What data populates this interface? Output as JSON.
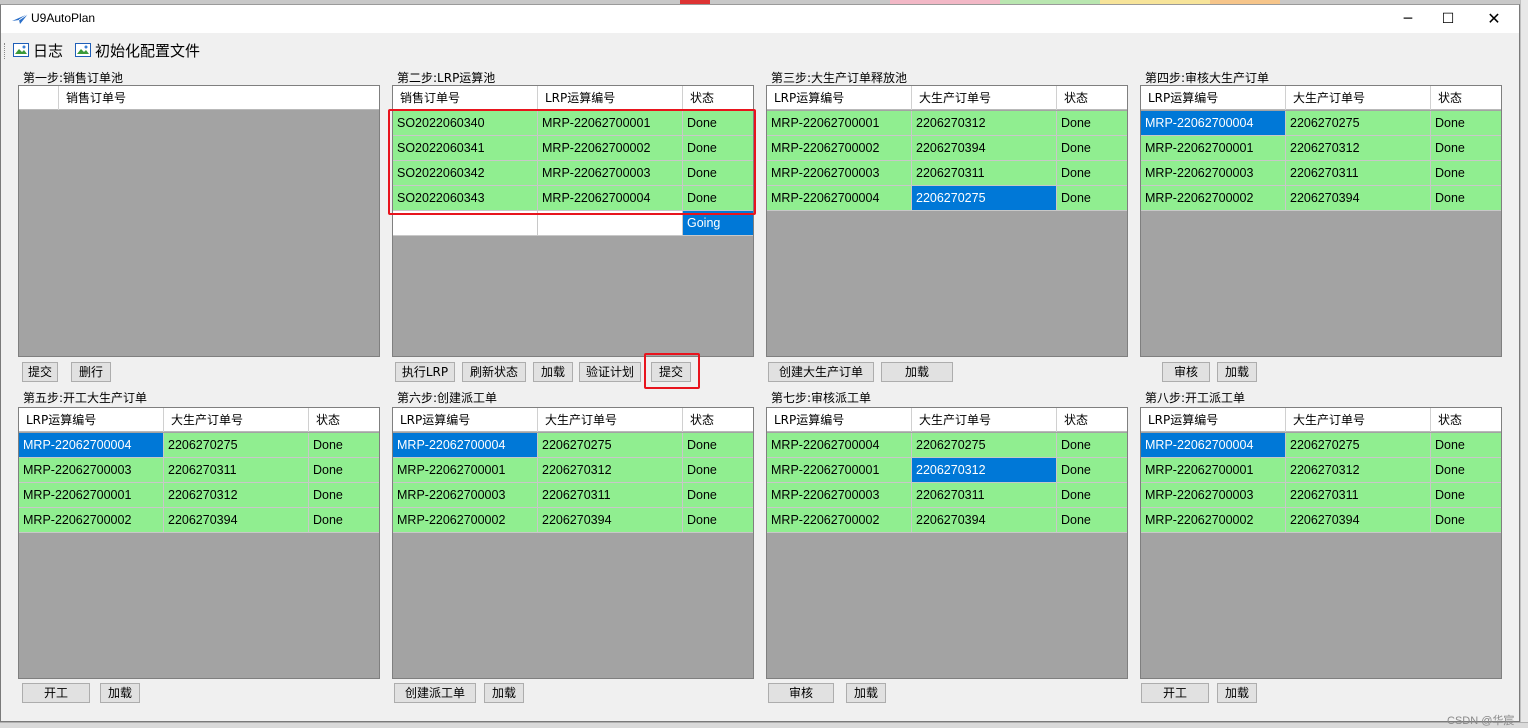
{
  "window": {
    "title": "U9AutoPlan",
    "minimize_glyph": "─",
    "maximize_glyph": "☐",
    "close_glyph": "✕"
  },
  "menu": {
    "log": "日志",
    "init_config": "初始化配置文件"
  },
  "panels": [
    {
      "title": "第一步:销售订单池",
      "columns": [
        "",
        "销售订单号"
      ],
      "rows": [],
      "buttons": [
        "提交",
        "删行"
      ]
    },
    {
      "title": "第二步:LRP运算池",
      "columns": [
        "销售订单号",
        "LRP运算编号",
        "状态"
      ],
      "rows": [
        [
          "SO2022060340",
          "MRP-22062700001",
          "Done"
        ],
        [
          "SO2022060341",
          "MRP-22062700002",
          "Done"
        ],
        [
          "SO2022060342",
          "MRP-22062700003",
          "Done"
        ],
        [
          "SO2022060343",
          "MRP-22062700004",
          "Done"
        ],
        [
          "",
          "",
          "Going"
        ]
      ],
      "buttons": [
        "执行LRP",
        "刷新状态",
        "加载",
        "验证计划",
        "提交"
      ]
    },
    {
      "title": "第三步:大生产订单释放池",
      "columns": [
        "LRP运算编号",
        "大生产订单号",
        "状态"
      ],
      "rows": [
        [
          "MRP-22062700001",
          "2206270312",
          "Done"
        ],
        [
          "MRP-22062700002",
          "2206270394",
          "Done"
        ],
        [
          "MRP-22062700003",
          "2206270311",
          "Done"
        ],
        [
          "MRP-22062700004",
          "2206270275",
          "Done"
        ]
      ],
      "buttons": [
        "创建大生产订单",
        "加载"
      ]
    },
    {
      "title": "第四步:审核大生产订单",
      "columns": [
        "LRP运算编号",
        "大生产订单号",
        "状态"
      ],
      "rows": [
        [
          "MRP-22062700004",
          "2206270275",
          "Done"
        ],
        [
          "MRP-22062700001",
          "2206270312",
          "Done"
        ],
        [
          "MRP-22062700003",
          "2206270311",
          "Done"
        ],
        [
          "MRP-22062700002",
          "2206270394",
          "Done"
        ]
      ],
      "buttons": [
        "审核",
        "加载"
      ]
    },
    {
      "title": "第五步:开工大生产订单",
      "columns": [
        "LRP运算编号",
        "大生产订单号",
        "状态"
      ],
      "rows": [
        [
          "MRP-22062700004",
          "2206270275",
          "Done"
        ],
        [
          "MRP-22062700003",
          "2206270311",
          "Done"
        ],
        [
          "MRP-22062700001",
          "2206270312",
          "Done"
        ],
        [
          "MRP-22062700002",
          "2206270394",
          "Done"
        ]
      ],
      "buttons": [
        "开工",
        "加载"
      ]
    },
    {
      "title": "第六步:创建派工单",
      "columns": [
        "LRP运算编号",
        "大生产订单号",
        "状态"
      ],
      "rows": [
        [
          "MRP-22062700004",
          "2206270275",
          "Done"
        ],
        [
          "MRP-22062700001",
          "2206270312",
          "Done"
        ],
        [
          "MRP-22062700003",
          "2206270311",
          "Done"
        ],
        [
          "MRP-22062700002",
          "2206270394",
          "Done"
        ]
      ],
      "buttons": [
        "创建派工单",
        "加载"
      ]
    },
    {
      "title": "第七步:审核派工单",
      "columns": [
        "LRP运算编号",
        "大生产订单号",
        "状态"
      ],
      "rows": [
        [
          "MRP-22062700004",
          "2206270275",
          "Done"
        ],
        [
          "MRP-22062700001",
          "2206270312",
          "Done"
        ],
        [
          "MRP-22062700003",
          "2206270311",
          "Done"
        ],
        [
          "MRP-22062700002",
          "2206270394",
          "Done"
        ]
      ],
      "buttons": [
        "审核",
        "加载"
      ]
    },
    {
      "title": "第八步:开工派工单",
      "columns": [
        "LRP运算编号",
        "大生产订单号",
        "状态"
      ],
      "rows": [
        [
          "MRP-22062700004",
          "2206270275",
          "Done"
        ],
        [
          "MRP-22062700001",
          "2206270312",
          "Done"
        ],
        [
          "MRP-22062700003",
          "2206270311",
          "Done"
        ],
        [
          "MRP-22062700002",
          "2206270394",
          "Done"
        ]
      ],
      "buttons": [
        "开工",
        "加载"
      ]
    }
  ],
  "watermark": "CSDN @华宸",
  "colors": {
    "row_done": "#90ee90",
    "row_selected": "#0078d7",
    "grid_empty": "#a3a3a3",
    "highlight_box": "#e8141d"
  },
  "icons": {
    "app": "send-arrow-icon",
    "menu_log": "image-icon",
    "menu_init": "image-icon"
  }
}
